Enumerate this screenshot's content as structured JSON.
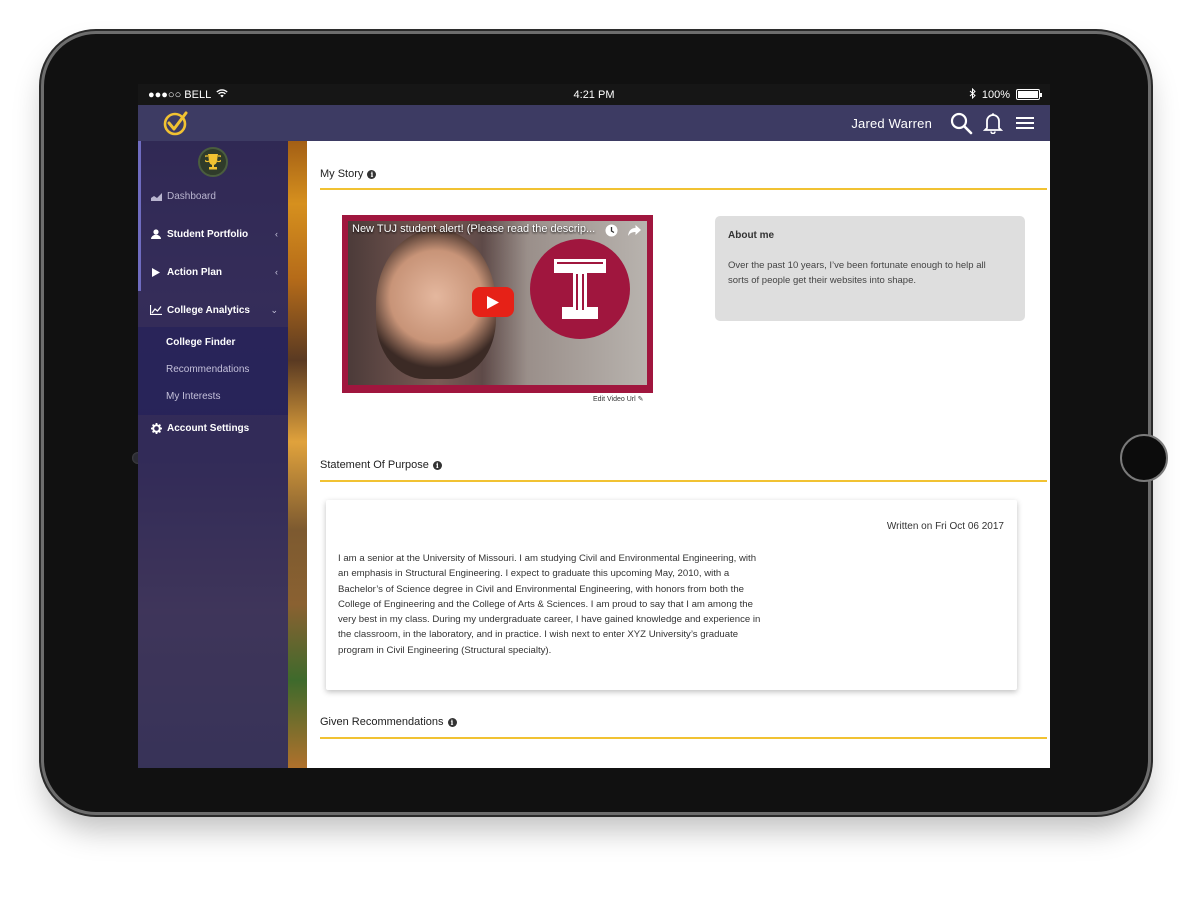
{
  "status_bar": {
    "carrier": "●●●○○ BELL",
    "time": "4:21 PM",
    "battery": "100%",
    "battery_level": 1.0
  },
  "header": {
    "user_name": "Jared Warren",
    "brand_color": "#3d3b63",
    "logo_color": "#f1c232"
  },
  "sidebar": {
    "items": [
      {
        "label": "Dashboard",
        "icon": "dashboard-icon"
      },
      {
        "label": "Student Portfolio",
        "icon": "user-icon"
      },
      {
        "label": "Action Plan",
        "icon": "play-icon"
      },
      {
        "label": "College Analytics",
        "icon": "chart-icon"
      },
      {
        "label": "Account Settings",
        "icon": "gear-icon"
      }
    ],
    "sub_items": [
      {
        "label": "College Finder",
        "active": true
      },
      {
        "label": "Recommendations",
        "active": false
      },
      {
        "label": "My Interests",
        "active": false
      }
    ]
  },
  "main": {
    "my_story": {
      "title": "My Story",
      "video_title": "New TUJ student alert! (Please read the descrip...",
      "edit_video_label": "Edit Video Url",
      "about_title": "About me",
      "about_text": "Over the past 10 years, I’ve been fortunate enough to help all sorts of people get their websites into shape."
    },
    "statement_of_purpose": {
      "title": "Statement Of Purpose",
      "written_on": "Written on Fri Oct 06 2017",
      "text": "I am a senior at the University of Missouri. I am studying Civil and Environmental Engineering, with an emphasis in Structural Engineering. I expect to graduate this upcoming May, 2010, with a Bachelor’s of Science degree in Civil and Environmental Engineering, with honors from both the College of Engineering and the College of Arts & Sciences. I am proud to say that I am among the very best in my class. During my undergraduate career, I have gained knowledge and experience in the classroom, in the laboratory, and in practice. I wish next to enter XYZ University’s graduate program in Civil Engineering (Structural specialty)."
    },
    "given_recommendations": {
      "title": "Given Recommendations"
    },
    "accent_color": "#f1c232"
  }
}
